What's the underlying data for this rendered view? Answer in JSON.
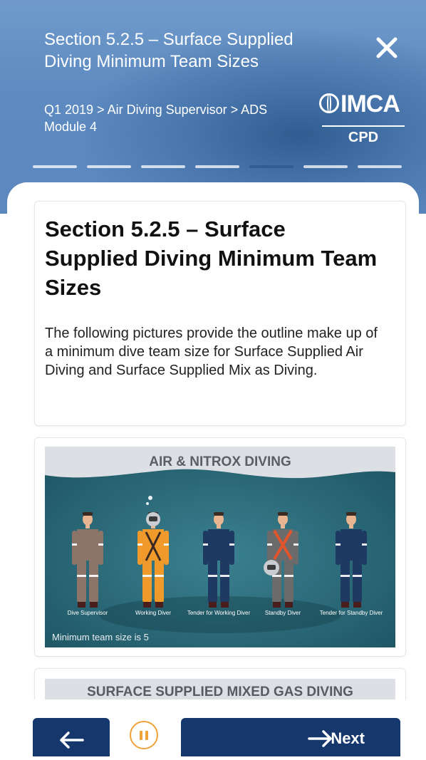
{
  "header": {
    "title": "Section 5.2.5 – Surface Supplied Diving Minimum Team Sizes",
    "breadcrumb": "Q1 2019 > Air Diving Supervisor > ADS Module 4",
    "logo_text": "IMCA",
    "logo_sub": "CPD",
    "close_icon": "close-icon",
    "progress": {
      "total": 7,
      "current": 5
    }
  },
  "content": {
    "title": "Section 5.2.5 – Surface Supplied Diving Minimum Team Sizes",
    "body": "The following pictures provide the outline make up of a minimum dive team size for Surface Supplied Air Diving and Surface Supplied Mix as Diving."
  },
  "figure1": {
    "title": "AIR & NITROX DIVING",
    "roles": [
      "Dive Supervisor",
      "Working Diver",
      "Tender for Working Diver",
      "Standby Diver",
      "Tender for Standby Diver"
    ],
    "caption": "Minimum team size is 5"
  },
  "figure2": {
    "title": "SURFACE SUPPLIED MIXED GAS DIVING"
  },
  "footer": {
    "back_icon": "arrow-left-icon",
    "pause_icon": "pause-icon",
    "next_label": "Next",
    "next_icon": "arrow-right-icon"
  },
  "colors": {
    "header_blue": "#5d8ac0",
    "button_navy": "#15376b",
    "pause_orange": "#f0a23a",
    "figure_teal": "#2e6e7c"
  }
}
